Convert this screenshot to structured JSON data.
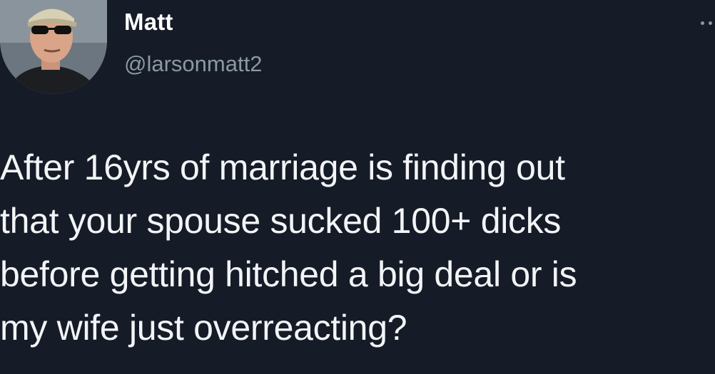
{
  "author": {
    "name": "Matt",
    "handle": "@larsonmatt2",
    "avatar": "profile-photo-man-cap-sunglasses"
  },
  "tweet": {
    "text": "After 16yrs of marriage is finding out\nthat your spouse sucked 100+ dicks\nbefore getting hitched a big deal or is\nmy wife just overreacting?"
  },
  "icons": {
    "more": "more-horizontal-icon"
  },
  "colors": {
    "background": "#151b27",
    "text": "#f2f4f6",
    "handle": "#8b98a5"
  }
}
